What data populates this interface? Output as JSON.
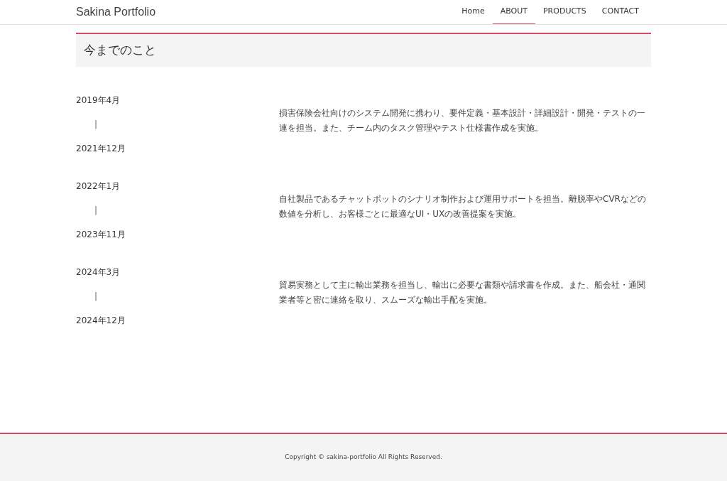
{
  "header": {
    "logo": "Sakina Portfolio",
    "nav": [
      {
        "label": "Home",
        "selected": false
      },
      {
        "label": "ABOUT",
        "selected": true
      },
      {
        "label": "PRODUCTS",
        "selected": false
      },
      {
        "label": "CONTACT",
        "selected": false
      }
    ]
  },
  "heading": "今までのこと",
  "timeline": [
    {
      "start": "2019年4月",
      "separator": "|",
      "end": "2021年12月",
      "description": "損害保険会社向けのシステム開発に携わり、要件定義・基本設計・詳細設計・開発・テストの一連を担当。また、チーム内のタスク管理やテスト仕様書作成を実施。"
    },
    {
      "start": "2022年1月",
      "separator": "|",
      "end": "2023年11月",
      "description": "自社製品であるチャットボットのシナリオ制作および運用サポートを担当。離脱率やCVRなどの数値を分析し、お客様ごとに最適なUI・UXの改善提案を実施。"
    },
    {
      "start": "2024年3月",
      "separator": "|",
      "end": "2024年12月",
      "description": "貿易実務として主に輸出業務を担当し、輸出に必要な書類や請求書を作成。また、船会社・通関業者等と密に連絡を取り、スムーズな輸出手配を実施。"
    }
  ],
  "footer": {
    "copyright": "Copyright © sakina-portfolio All Rights Reserved."
  }
}
